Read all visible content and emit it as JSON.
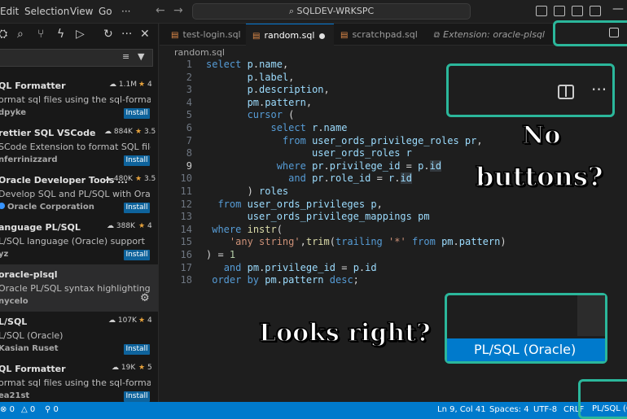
{
  "menu": {
    "edit": "Edit",
    "selection": "Selection",
    "view": "View",
    "go": "Go",
    "more": "···"
  },
  "command_center": {
    "label": "SQLDEV-WRKSPC"
  },
  "sidebar": {
    "extensions": [
      {
        "name": "QL Formatter",
        "desc": "ormat sql files using the sql-formatter ...",
        "publisher": "dpyke",
        "downloads": "1.1M",
        "rating": "4",
        "action": "Install"
      },
      {
        "name": "rettier SQL VSCode",
        "desc": "SCode Extension to format SQL files",
        "publisher": "nferrinizzard",
        "downloads": "884K",
        "rating": "3.5",
        "action": "Install"
      },
      {
        "name": "Oracle Developer Tools ...",
        "desc": "Develop SQL and PL/SQL with Oracle D...",
        "publisher": "Oracle Corporation",
        "downloads": "480K",
        "rating": "3.5",
        "action": "Install"
      },
      {
        "name": "anguage PL/SQL",
        "desc": "L/SQL language (Oracle) support",
        "publisher": "yz",
        "downloads": "388K",
        "rating": "4",
        "action": "Install"
      },
      {
        "name": "oracle-plsql",
        "desc": "Oracle PL/SQL syntax highlighting",
        "publisher": "nycelo",
        "downloads": "",
        "rating": "",
        "action": ""
      },
      {
        "name": "L/SQL",
        "desc": "L/SQL (Oracle)",
        "publisher": "Kasian Ruset",
        "downloads": "107K",
        "rating": "4",
        "action": "Install"
      },
      {
        "name": "QL Formatter",
        "desc": "ormat sql files using the sql-formatter ...",
        "publisher": "ea21st",
        "downloads": "19K",
        "rating": "5",
        "action": "Install"
      }
    ]
  },
  "tabs": [
    {
      "label": "test-login.sql"
    },
    {
      "label": "random.sql"
    },
    {
      "label": "scratchpad.sql"
    },
    {
      "label": "Extension: oracle-plsql"
    }
  ],
  "breadcrumb": "random.sql",
  "code_lines": [
    {
      "n": "1",
      "html": "<span class='kw'>select</span> <span class='id'>p</span>.<span class='id'>name</span>,"
    },
    {
      "n": "2",
      "html": "       <span class='id'>p</span>.<span class='id'>label</span>,"
    },
    {
      "n": "3",
      "html": "       <span class='id'>p</span>.<span class='id'>description</span>,"
    },
    {
      "n": "4",
      "html": "       <span class='id'>pm</span>.<span class='id'>pattern</span>,"
    },
    {
      "n": "5",
      "html": "       <span class='kw'>cursor</span> ("
    },
    {
      "n": "6",
      "html": "           <span class='kw'>select</span> <span class='id'>r</span>.<span class='id'>name</span>"
    },
    {
      "n": "7",
      "html": "             <span class='kw'>from</span> <span class='id'>user_ords_privilege_roles</span> <span class='id'>pr</span>,"
    },
    {
      "n": "8",
      "html": "                  <span class='id'>user_ords_roles</span> <span class='id'>r</span>"
    },
    {
      "n": "9",
      "html": "            <span class='kw'>where</span> <span class='id'>pr</span>.<span class='id'>privilege_id</span> = <span class='id'>p</span>.<span class='id hl'>id</span>"
    },
    {
      "n": "10",
      "html": "              <span class='kw'>and</span> <span class='id'>pr</span>.<span class='id'>role_id</span> = <span class='id'>r</span>.<span class='id hl'>id</span>"
    },
    {
      "n": "11",
      "html": "       ) <span class='id'>roles</span>"
    },
    {
      "n": "12",
      "html": "  <span class='kw'>from</span> <span class='id'>user_ords_privileges</span> <span class='id'>p</span>,"
    },
    {
      "n": "13",
      "html": "       <span class='id'>user_ords_privilege_mappings</span> <span class='id'>pm</span>"
    },
    {
      "n": "14",
      "html": " <span class='kw'>where</span> <span class='fn'>instr</span>("
    },
    {
      "n": "15",
      "html": "    <span class='str'>'any string'</span>,<span class='fn'>trim</span>(<span class='kw'>trailing</span> <span class='str'>'*'</span> <span class='kw'>from</span> <span class='id'>pm</span>.<span class='id'>pattern</span>)"
    },
    {
      "n": "16",
      "html": ") = <span class='num'>1</span>"
    },
    {
      "n": "17",
      "html": "   <span class='kw'>and</span> <span class='id'>pm</span>.<span class='id'>privilege_id</span> = <span class='id'>p</span>.<span class='id'>id</span>"
    },
    {
      "n": "18",
      "html": " <span class='kw'>order by</span> <span class='id'>pm</span>.<span class='id'>pattern</span> <span class='kw'>desc</span>;"
    }
  ],
  "annotations": {
    "no_buttons_1": "No",
    "no_buttons_2": "buttons?",
    "looks_right": "Looks right?",
    "zoom_language": "PL/SQL (Oracle)"
  },
  "status": {
    "errors": "0",
    "warnings": "0",
    "ports": "0",
    "position": "Ln 9, Col 41",
    "spaces": "Spaces: 4",
    "encoding": "UTF-8",
    "eol": "CRLF",
    "language": "PL/SQL (O"
  },
  "colors": {
    "accent": "#007acc",
    "callout": "#2bb79b",
    "install": "#0e639c"
  }
}
